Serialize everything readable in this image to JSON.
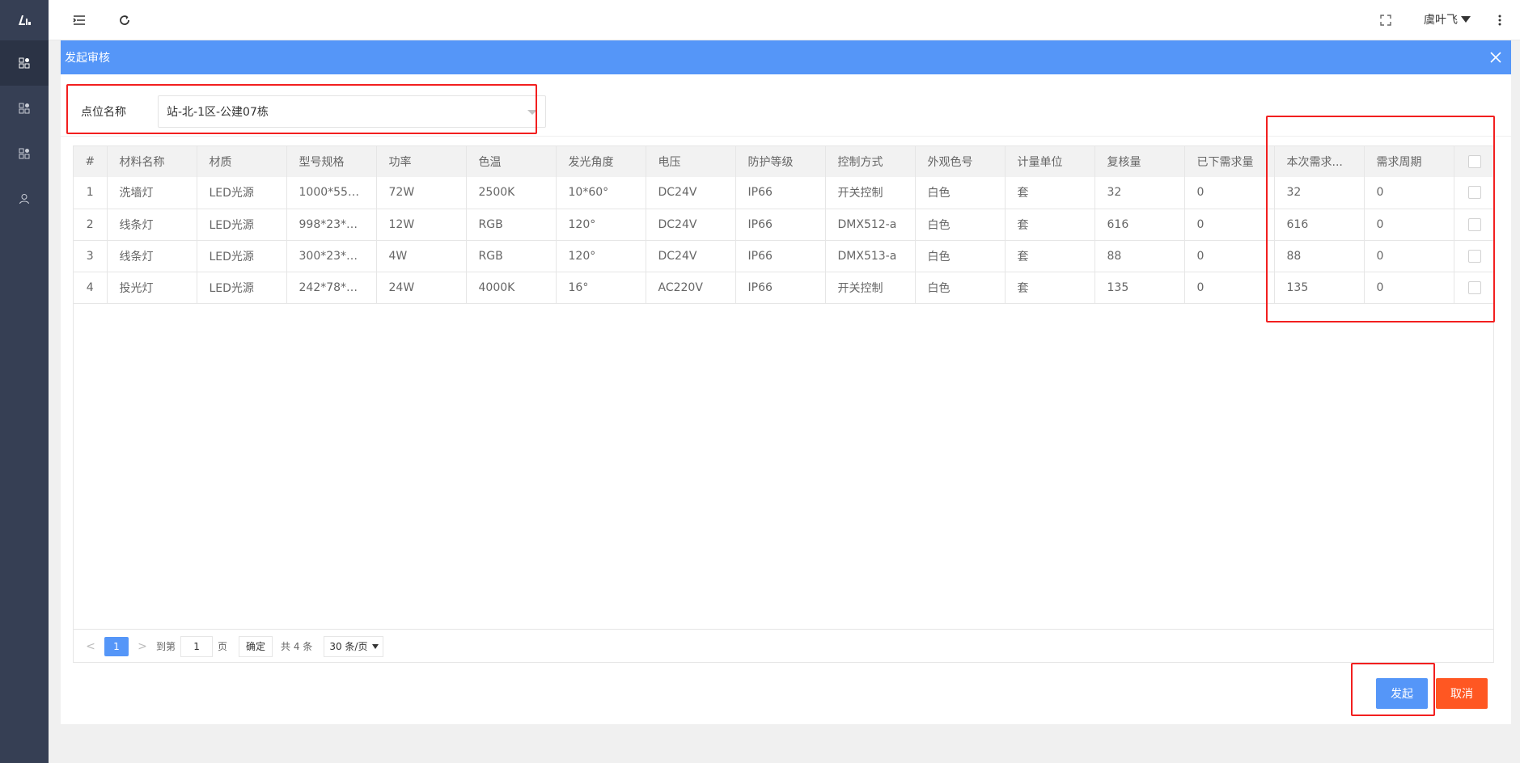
{
  "topbar": {
    "user_name": "虞叶飞"
  },
  "modal": {
    "title": "发起审核",
    "filter": {
      "label": "点位名称",
      "value": "站-北-1区-公建07栋"
    },
    "table": {
      "columns": [
        "#",
        "材料名称",
        "材质",
        "型号规格",
        "功率",
        "色温",
        "发光角度",
        "电压",
        "防护等级",
        "控制方式",
        "外观色号",
        "计量单位",
        "复核量",
        "已下需求量",
        "本次需求...",
        "需求周期"
      ],
      "rows": [
        [
          "1",
          "洗墙灯",
          "LED光源",
          "1000*55*...",
          "72W",
          "2500K",
          "10*60°",
          "DC24V",
          "IP66",
          "开关控制",
          "白色",
          "套",
          "32",
          "0",
          "32",
          "0"
        ],
        [
          "2",
          "线条灯",
          "LED光源",
          "998*23*H...",
          "12W",
          "RGB",
          "120°",
          "DC24V",
          "IP66",
          "DMX512-a",
          "白色",
          "套",
          "616",
          "0",
          "616",
          "0"
        ],
        [
          "3",
          "线条灯",
          "LED光源",
          "300*23*H...",
          "4W",
          "RGB",
          "120°",
          "DC24V",
          "IP66",
          "DMX513-a",
          "白色",
          "套",
          "88",
          "0",
          "88",
          "0"
        ],
        [
          "4",
          "投光灯",
          "LED光源",
          "242*78*19...",
          "24W",
          "4000K",
          "16°",
          "AC220V",
          "IP66",
          "开关控制",
          "白色",
          "套",
          "135",
          "0",
          "135",
          "0"
        ]
      ]
    },
    "pager": {
      "current": "1",
      "goto_label": "到第",
      "goto_value": "1",
      "page_unit": "页",
      "confirm": "确定",
      "total": "共 4 条",
      "page_size": "30 条/页"
    },
    "buttons": {
      "submit": "发起",
      "cancel": "取消"
    }
  },
  "colors": {
    "sidebar": "#363f54",
    "header_blue": "#5596f8",
    "cancel_orange": "#ff5722",
    "highlight_red": "#f21f1f"
  },
  "icons": {
    "logo": "logo-icon",
    "sidebar": [
      "dashboard-icon",
      "apps-icon",
      "apps-icon",
      "user-icon"
    ],
    "toolbar": [
      "menu-fold-icon",
      "refresh-icon",
      "fullscreen-icon",
      "more-icon"
    ]
  }
}
